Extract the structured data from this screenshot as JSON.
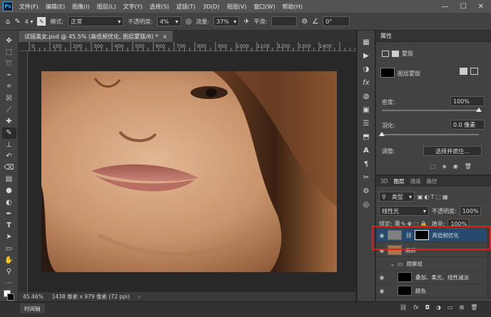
{
  "app": {
    "logo": "Ps"
  },
  "menu": [
    "文件(F)",
    "编辑(E)",
    "图像(I)",
    "图层(L)",
    "文字(Y)",
    "选择(S)",
    "滤镜(T)",
    "3D(D)",
    "视图(V)",
    "窗口(W)",
    "帮助(H)"
  ],
  "window_controls": [
    "—",
    "☐",
    "✕"
  ],
  "options": {
    "mode_label": "模式:",
    "mode_value": "正常",
    "opacity_label": "不透明度:",
    "opacity_value": "4%",
    "flow_label": "流量:",
    "flow_value": "37%",
    "smooth_label": "平滑:",
    "angle_value": "0°",
    "brush_size": "4"
  },
  "document": {
    "tab_title": "试镜美女.psd @ 45.5% (高低频优化, 图层蒙版/8) *",
    "close": "×"
  },
  "ruler_ticks": [
    "0",
    "100",
    "200",
    "300",
    "400",
    "500",
    "600",
    "700",
    "800",
    "900",
    "1000",
    "1100",
    "1200",
    "1300",
    "1400"
  ],
  "status": {
    "zoom": "45.46%",
    "doc_info": "1438 像素 x 979 像素 (72 ppi)",
    "arrow": "›"
  },
  "timeline_tab": "时间轴",
  "properties": {
    "title": "属性",
    "section": "蒙版",
    "layer_mask": "图层蒙版",
    "density_label": "密度:",
    "density_value": "100%",
    "density": 1.0,
    "feather_label": "羽化:",
    "feather_value": "0.0 像素",
    "feather": 0.0,
    "adjust_label": "调整:",
    "select_mask_button": "选择并遮住..."
  },
  "layers_panel": {
    "tabs": [
      "3D",
      "图层",
      "通道",
      "路径"
    ],
    "kind_label": "类型",
    "blend_mode": "线性光",
    "opacity_label": "不透明度:",
    "opacity_value": "100%",
    "lock_label": "锁定:",
    "fill_label": "填充:",
    "fill_value": "100%",
    "layers": [
      {
        "name": "高低频优化",
        "selected": true
      },
      {
        "name": "画卯",
        "selected": false
      },
      {
        "name": "观察组",
        "selected": false
      },
      {
        "name": "叠加、柔光、线性减淡",
        "selected": false
      },
      {
        "name": "颜色",
        "selected": false
      }
    ]
  },
  "colors": {
    "selection_outline": "#e02020",
    "accent": "#31a8ff",
    "selected_layer": "#264a6e"
  }
}
